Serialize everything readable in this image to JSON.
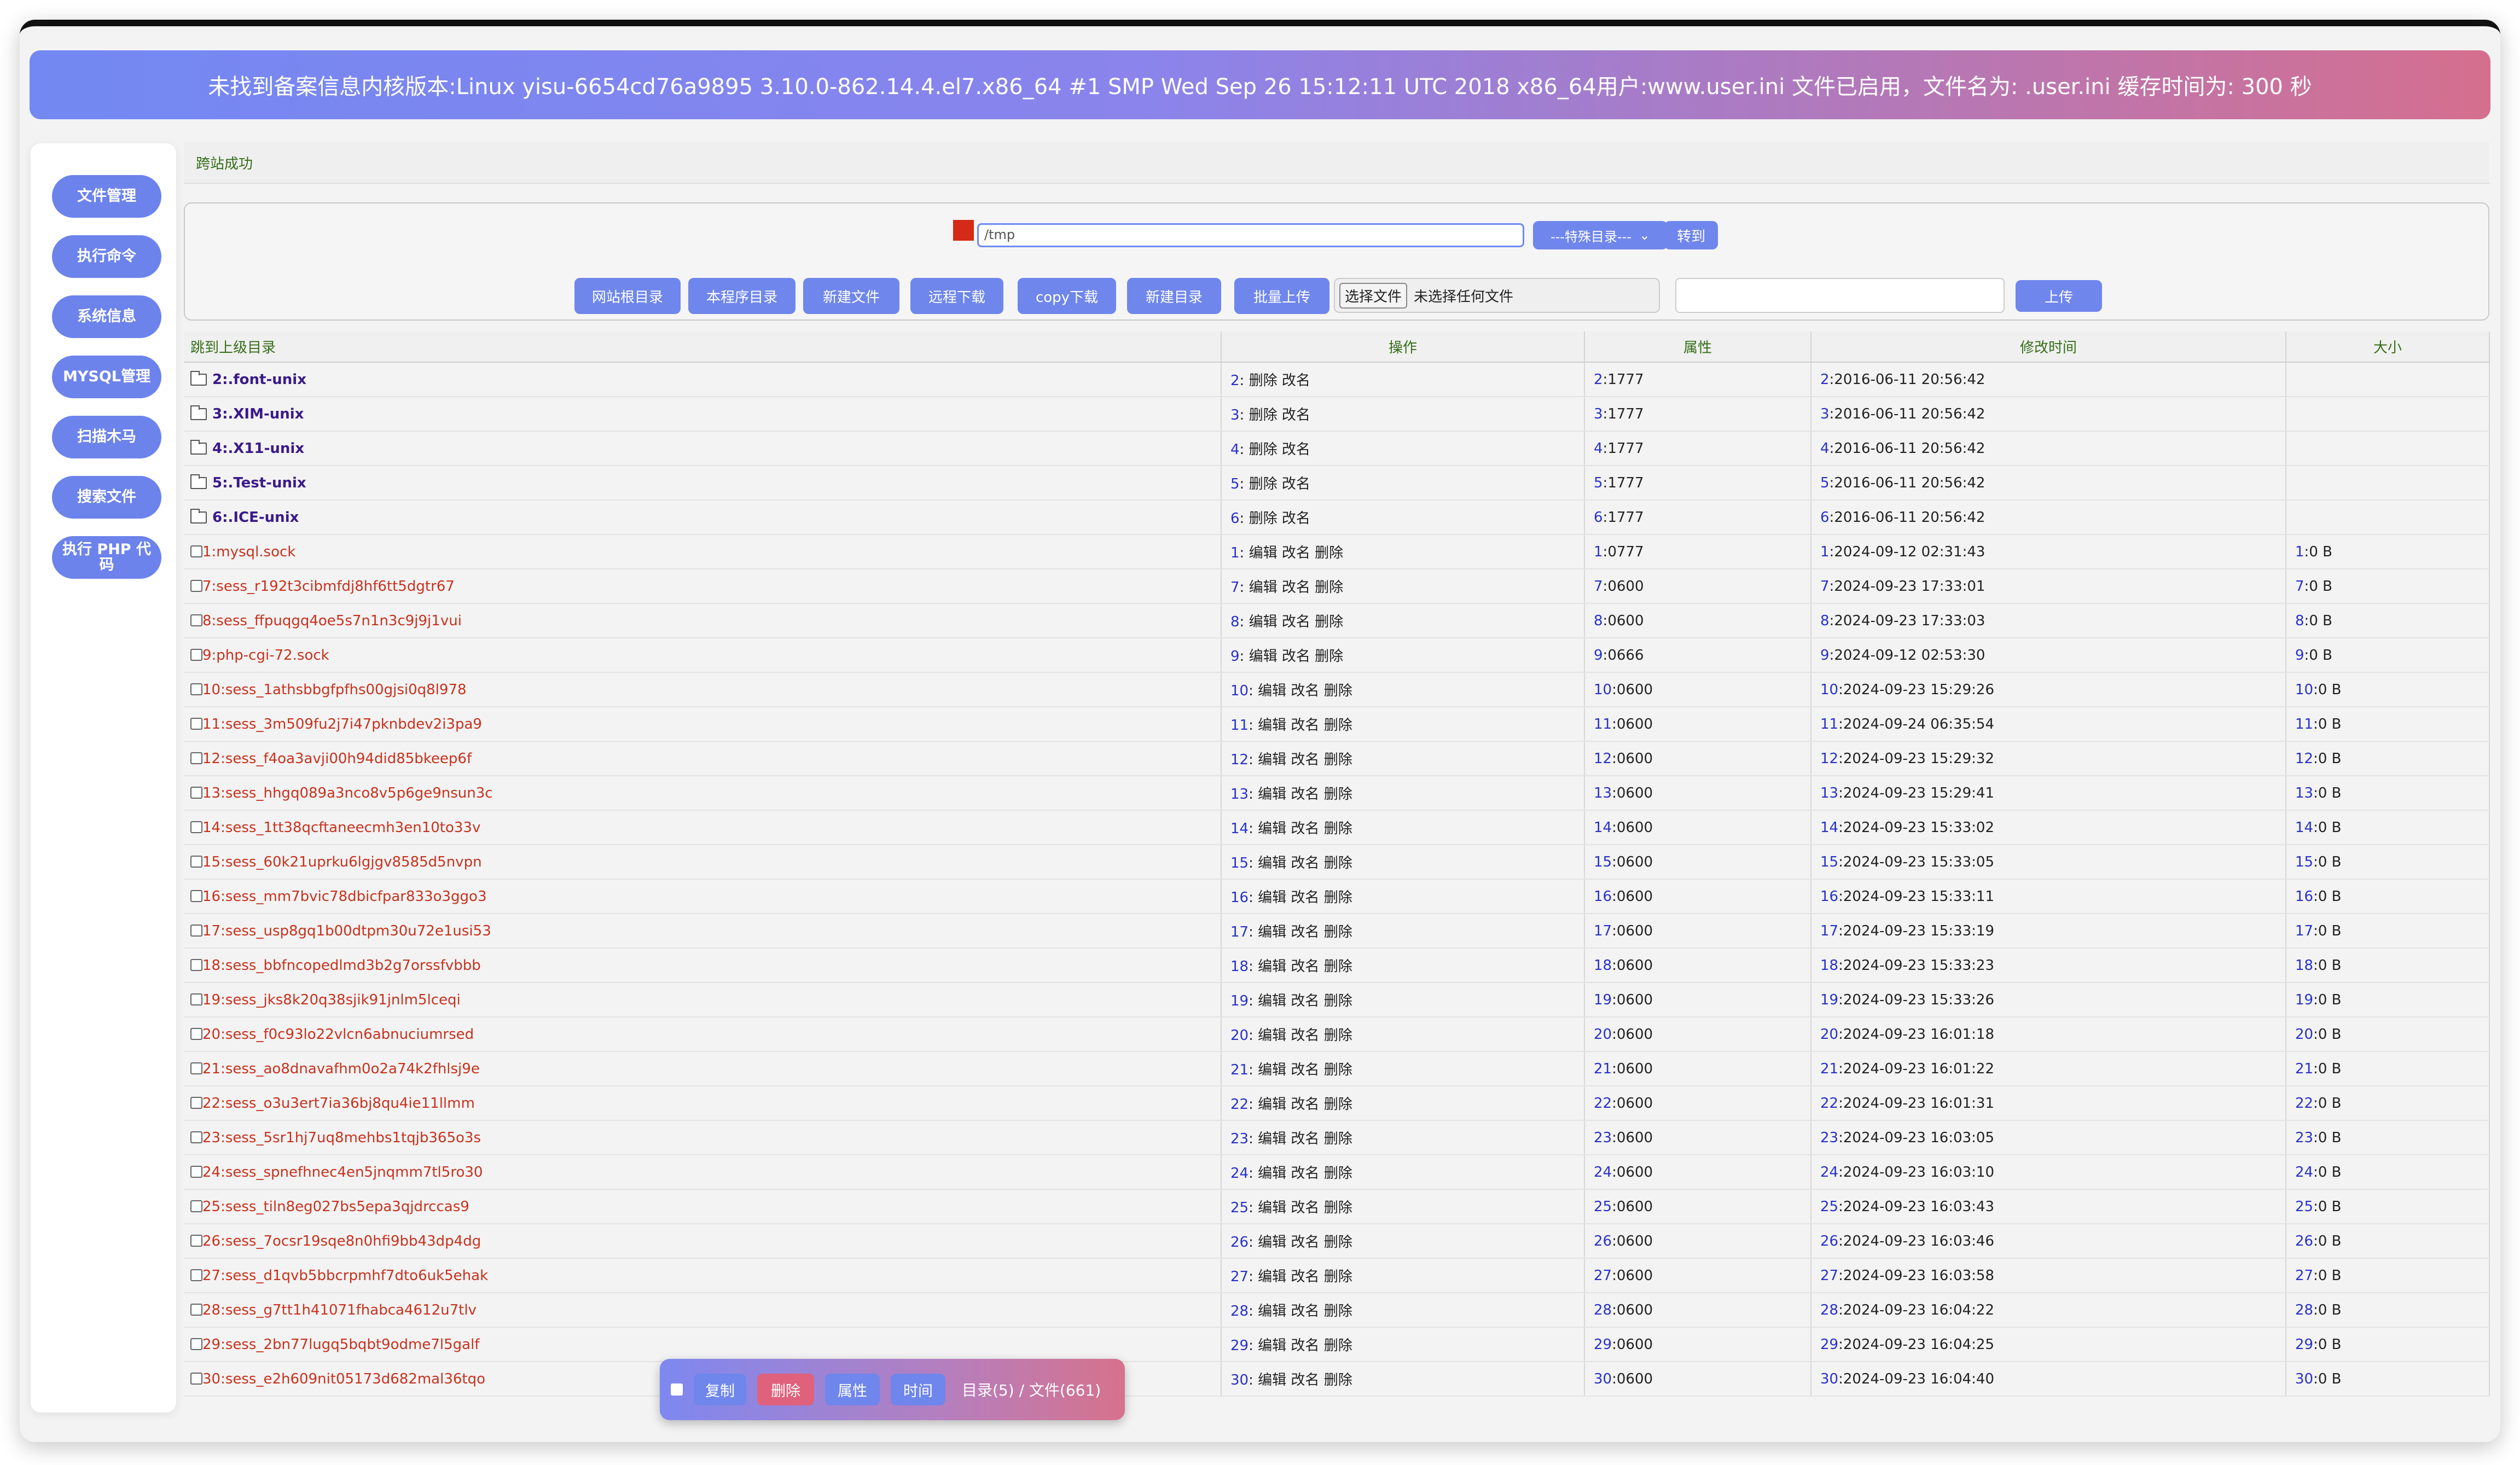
{
  "header": {
    "banner": "未找到备案信息内核版本:Linux yisu-6654cd76a9895 3.10.0-862.14.4.el7.x86_64 #1 SMP Wed Sep 26 15:12:11 UTC 2018 x86_64用户:www.user.ini 文件已启用，文件名为: .user.ini 缓存时间为: 300 秒"
  },
  "sidebar": {
    "items": [
      {
        "label": "文件管理"
      },
      {
        "label": "执行命令"
      },
      {
        "label": "系统信息"
      },
      {
        "label": "MYSQL管理"
      },
      {
        "label": "扫描木马"
      },
      {
        "label": "搜索文件"
      },
      {
        "label": "执行 PHP 代码"
      }
    ]
  },
  "message": "跨站成功",
  "toolbar": {
    "path_value": "/tmp",
    "special_dir": "---特殊目录---",
    "go_label": "转到",
    "buttons": [
      "网站根目录",
      "本程序目录",
      "新建文件",
      "远程下载",
      "copy下载",
      "新建目录",
      "批量上传"
    ],
    "file_pick_label": "选择文件",
    "file_pick_status": "未选择任何文件",
    "upload_label": "上传"
  },
  "table": {
    "headers": [
      "跳到上级目录",
      "操作",
      "属性",
      "修改时间",
      "大小"
    ],
    "dirs": [
      {
        "num": "2",
        "name": "2:.font-unix",
        "perm": "1777",
        "mtime": "2016-06-11 20:56:42"
      },
      {
        "num": "3",
        "name": "3:.XIM-unix",
        "perm": "1777",
        "mtime": "2016-06-11 20:56:42"
      },
      {
        "num": "4",
        "name": "4:.X11-unix",
        "perm": "1777",
        "mtime": "2016-06-11 20:56:42"
      },
      {
        "num": "5",
        "name": "5:.Test-unix",
        "perm": "1777",
        "mtime": "2016-06-11 20:56:42"
      },
      {
        "num": "6",
        "name": "6:.ICE-unix",
        "perm": "1777",
        "mtime": "2016-06-11 20:56:42"
      }
    ],
    "files": [
      {
        "num": "1",
        "name": "1:mysql.sock",
        "perm": "0777",
        "mtime": "2024-09-12 02:31:43",
        "size": "0 B"
      },
      {
        "num": "7",
        "name": "7:sess_r192t3cibmfdj8hf6tt5dgtr67",
        "perm": "0600",
        "mtime": "2024-09-23 17:33:01",
        "size": "0 B"
      },
      {
        "num": "8",
        "name": "8:sess_ffpuqgq4oe5s7n1n3c9j9j1vui",
        "perm": "0600",
        "mtime": "2024-09-23 17:33:03",
        "size": "0 B"
      },
      {
        "num": "9",
        "name": "9:php-cgi-72.sock",
        "perm": "0666",
        "mtime": "2024-09-12 02:53:30",
        "size": "0 B"
      },
      {
        "num": "10",
        "name": "10:sess_1athsbbgfpfhs00gjsi0q8l978",
        "perm": "0600",
        "mtime": "2024-09-23 15:29:26",
        "size": "0 B"
      },
      {
        "num": "11",
        "name": "11:sess_3m509fu2j7i47pknbdev2i3pa9",
        "perm": "0600",
        "mtime": "2024-09-24 06:35:54",
        "size": "0 B"
      },
      {
        "num": "12",
        "name": "12:sess_f4oa3avji00h94did85bkeep6f",
        "perm": "0600",
        "mtime": "2024-09-23 15:29:32",
        "size": "0 B"
      },
      {
        "num": "13",
        "name": "13:sess_hhgq089a3nco8v5p6ge9nsun3c",
        "perm": "0600",
        "mtime": "2024-09-23 15:29:41",
        "size": "0 B"
      },
      {
        "num": "14",
        "name": "14:sess_1tt38qcftaneecmh3en10to33v",
        "perm": "0600",
        "mtime": "2024-09-23 15:33:02",
        "size": "0 B"
      },
      {
        "num": "15",
        "name": "15:sess_60k21uprku6lgjgv8585d5nvpn",
        "perm": "0600",
        "mtime": "2024-09-23 15:33:05",
        "size": "0 B"
      },
      {
        "num": "16",
        "name": "16:sess_mm7bvic78dbicfpar833o3ggo3",
        "perm": "0600",
        "mtime": "2024-09-23 15:33:11",
        "size": "0 B"
      },
      {
        "num": "17",
        "name": "17:sess_usp8gq1b00dtpm30u72e1usi53",
        "perm": "0600",
        "mtime": "2024-09-23 15:33:19",
        "size": "0 B"
      },
      {
        "num": "18",
        "name": "18:sess_bbfncopedlmd3b2g7orssfvbbb",
        "perm": "0600",
        "mtime": "2024-09-23 15:33:23",
        "size": "0 B"
      },
      {
        "num": "19",
        "name": "19:sess_jks8k20q38sjik91jnlm5lceqi",
        "perm": "0600",
        "mtime": "2024-09-23 15:33:26",
        "size": "0 B"
      },
      {
        "num": "20",
        "name": "20:sess_f0c93lo22vlcn6abnuciumrsed",
        "perm": "0600",
        "mtime": "2024-09-23 16:01:18",
        "size": "0 B"
      },
      {
        "num": "21",
        "name": "21:sess_ao8dnavafhm0o2a74k2fhlsj9e",
        "perm": "0600",
        "mtime": "2024-09-23 16:01:22",
        "size": "0 B"
      },
      {
        "num": "22",
        "name": "22:sess_o3u3ert7ia36bj8qu4ie11llmm",
        "perm": "0600",
        "mtime": "2024-09-23 16:01:31",
        "size": "0 B"
      },
      {
        "num": "23",
        "name": "23:sess_5sr1hj7uq8mehbs1tqjb365o3s",
        "perm": "0600",
        "mtime": "2024-09-23 16:03:05",
        "size": "0 B"
      },
      {
        "num": "24",
        "name": "24:sess_spnefhnec4en5jnqmm7tl5ro30",
        "perm": "0600",
        "mtime": "2024-09-23 16:03:10",
        "size": "0 B"
      },
      {
        "num": "25",
        "name": "25:sess_tiln8eg027bs5epa3qjdrccas9",
        "perm": "0600",
        "mtime": "2024-09-23 16:03:43",
        "size": "0 B"
      },
      {
        "num": "26",
        "name": "26:sess_7ocsr19sqe8n0hfi9bb43dp4dg",
        "perm": "0600",
        "mtime": "2024-09-23 16:03:46",
        "size": "0 B"
      },
      {
        "num": "27",
        "name": "27:sess_d1qvb5bbcrpmhf7dto6uk5ehak",
        "perm": "0600",
        "mtime": "2024-09-23 16:03:58",
        "size": "0 B"
      },
      {
        "num": "28",
        "name": "28:sess_g7tt1h41071fhabca4612u7tlv",
        "perm": "0600",
        "mtime": "2024-09-23 16:04:22",
        "size": "0 B"
      },
      {
        "num": "29",
        "name": "29:sess_2bn77lugq5bqbt9odme7l5galf",
        "perm": "0600",
        "mtime": "2024-09-23 16:04:25",
        "size": "0 B"
      },
      {
        "num": "30",
        "name": "30:sess_e2h609nit05173d682mal36tqo",
        "perm": "0600",
        "mtime": "2024-09-23 16:04:40",
        "size": "0 B"
      }
    ],
    "dir_ops": [
      "删除",
      "改名"
    ],
    "file_ops": [
      "编辑",
      "改名",
      "删除"
    ]
  },
  "floatbar": {
    "buttons": [
      "复制",
      "删除",
      "属性",
      "时间"
    ],
    "summary": "目录(5) / 文件(661)"
  },
  "colors": {
    "accent": "#6f86ec",
    "danger": "#e0617b",
    "banner_start": "#7388f2",
    "banner_end": "#d56f8f",
    "dir_link": "#3a1a8a",
    "file_link": "#c8321e",
    "index": "#2832c9",
    "header_text": "#356e18"
  }
}
